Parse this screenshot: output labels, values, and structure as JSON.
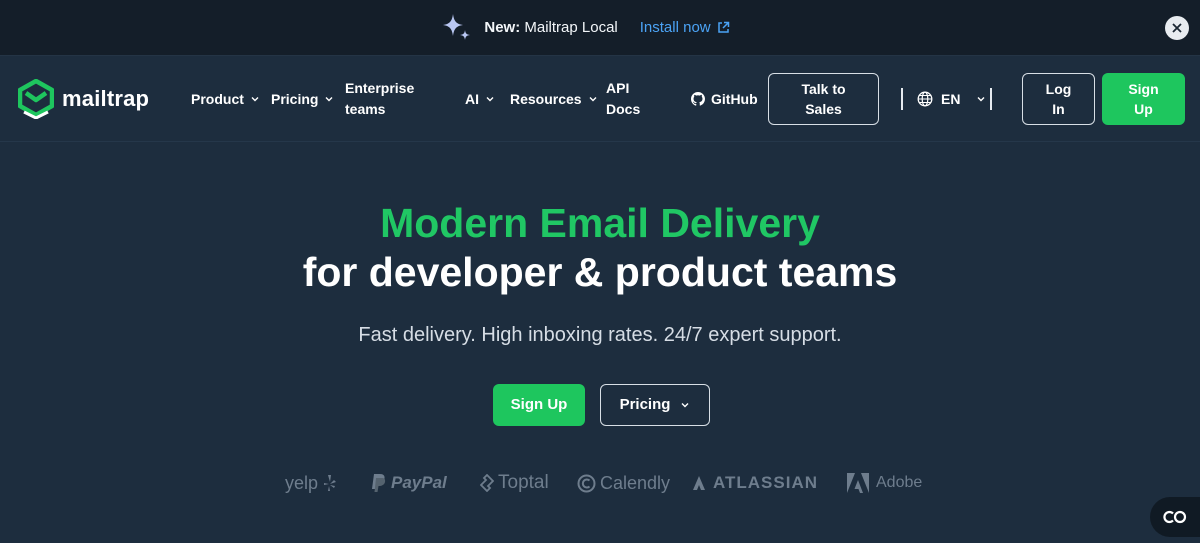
{
  "announcement": {
    "new_label": "New:",
    "product": " Mailtrap Local",
    "install_link": "Install now"
  },
  "nav": {
    "brand": "mailtrap",
    "items": [
      {
        "label": "Product"
      },
      {
        "label": "Pricing"
      },
      {
        "label": "Enterprise teams"
      },
      {
        "label": "AI"
      },
      {
        "label": "Resources"
      },
      {
        "label": "API Docs"
      },
      {
        "label": "GitHub"
      }
    ],
    "talk_to_sales": "Talk to Sales",
    "language": "EN",
    "login": "Log In",
    "signup": "Sign Up"
  },
  "hero": {
    "title_line1": "Modern Email Delivery",
    "title_line2": "for developer & product teams",
    "subtitle": "Fast delivery. High inboxing rates. 24/7 expert support.",
    "cta_signup": "Sign Up",
    "cta_pricing": "Pricing"
  },
  "customer_logos": [
    "yelp",
    "PayPal",
    "Toptal",
    "Calendly",
    "ATLASSIAN",
    "Adobe"
  ],
  "colors": {
    "accent_green": "#1ec65e",
    "background": "#1d2d3e",
    "announcement_bg": "#141e29",
    "link_blue": "#4ba3f5",
    "logo_gray": "#6e7d8d"
  },
  "icons": [
    "sparkle-icon",
    "external-link-icon",
    "close-icon",
    "chevron-down-icon",
    "github-icon",
    "globe-icon",
    "chat-icon"
  ]
}
